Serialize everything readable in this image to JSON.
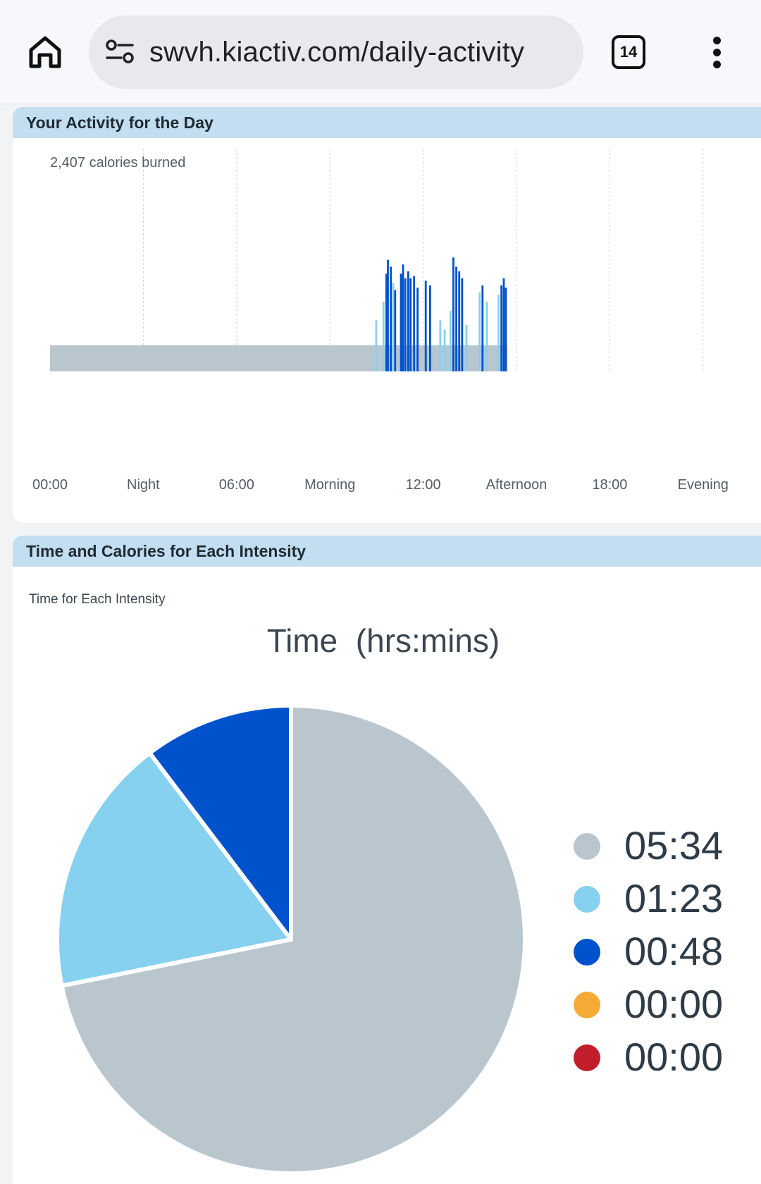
{
  "browser": {
    "url": "swvh.kiactiv.com/daily-activity",
    "tab_count": "14",
    "home_icon": "home-icon",
    "site_info_icon": "site-settings-icon",
    "menu_icon": "more-vert-icon"
  },
  "activity_card": {
    "title": "Your Activity for the Day",
    "calories": "2,407 calories burned"
  },
  "intensity_card": {
    "title": "Time and Calories for Each Intensity",
    "subtitle": "Time for Each Intensity"
  },
  "colors": {
    "header_bg": "#c3def0",
    "sedentary": "#b9c6ce",
    "light": "#86d0f0",
    "moderate": "#0052cc",
    "vigorous": "#f5ab35",
    "very_vigorous": "#c01f2b"
  },
  "chart_data": [
    {
      "type": "bar",
      "x_labels": [
        "00:00",
        "Night",
        "06:00",
        "Morning",
        "12:00",
        "Afternoon",
        "18:00",
        "Evening"
      ],
      "grid": "vertical dashed lines at each label",
      "baseline_range_hours": [
        0,
        15.7
      ],
      "baseline_level": 0.1,
      "ylim": [
        0,
        1
      ],
      "spikes": [
        {
          "h": 11.2,
          "v": 0.22,
          "c": "light"
        },
        {
          "h": 11.45,
          "v": 0.3,
          "c": "light"
        },
        {
          "h": 11.55,
          "v": 0.42,
          "c": "moderate"
        },
        {
          "h": 11.6,
          "v": 0.48,
          "c": "moderate"
        },
        {
          "h": 11.7,
          "v": 0.45,
          "c": "moderate"
        },
        {
          "h": 11.78,
          "v": 0.38,
          "c": "light"
        },
        {
          "h": 11.85,
          "v": 0.35,
          "c": "moderate"
        },
        {
          "h": 12.05,
          "v": 0.42,
          "c": "moderate"
        },
        {
          "h": 12.12,
          "v": 0.46,
          "c": "moderate"
        },
        {
          "h": 12.2,
          "v": 0.4,
          "c": "moderate"
        },
        {
          "h": 12.3,
          "v": 0.43,
          "c": "moderate"
        },
        {
          "h": 12.38,
          "v": 0.4,
          "c": "moderate"
        },
        {
          "h": 12.5,
          "v": 0.41,
          "c": "moderate"
        },
        {
          "h": 12.62,
          "v": 0.36,
          "c": "moderate"
        },
        {
          "h": 12.9,
          "v": 0.39,
          "c": "moderate"
        },
        {
          "h": 13.05,
          "v": 0.37,
          "c": "moderate"
        },
        {
          "h": 13.4,
          "v": 0.22,
          "c": "light"
        },
        {
          "h": 13.55,
          "v": 0.18,
          "c": "light"
        },
        {
          "h": 13.75,
          "v": 0.26,
          "c": "light"
        },
        {
          "h": 13.85,
          "v": 0.49,
          "c": "moderate"
        },
        {
          "h": 13.95,
          "v": 0.45,
          "c": "moderate"
        },
        {
          "h": 14.05,
          "v": 0.43,
          "c": "moderate"
        },
        {
          "h": 14.15,
          "v": 0.4,
          "c": "moderate"
        },
        {
          "h": 14.3,
          "v": 0.2,
          "c": "light"
        },
        {
          "h": 14.75,
          "v": 0.34,
          "c": "light"
        },
        {
          "h": 14.85,
          "v": 0.37,
          "c": "moderate"
        },
        {
          "h": 15.0,
          "v": 0.3,
          "c": "light"
        },
        {
          "h": 15.4,
          "v": 0.33,
          "c": "light"
        },
        {
          "h": 15.5,
          "v": 0.37,
          "c": "moderate"
        },
        {
          "h": 15.58,
          "v": 0.4,
          "c": "moderate"
        },
        {
          "h": 15.65,
          "v": 0.36,
          "c": "moderate"
        }
      ]
    },
    {
      "type": "pie",
      "title": "Time  (hrs:mins)",
      "legend_position": "right",
      "slices": [
        {
          "label": "05:34",
          "minutes": 334,
          "color": "#b9c6ce"
        },
        {
          "label": "01:23",
          "minutes": 83,
          "color": "#86d0f0"
        },
        {
          "label": "00:48",
          "minutes": 48,
          "color": "#0052cc"
        },
        {
          "label": "00:00",
          "minutes": 0,
          "color": "#f5ab35"
        },
        {
          "label": "00:00",
          "minutes": 0,
          "color": "#c01f2b"
        }
      ]
    }
  ]
}
